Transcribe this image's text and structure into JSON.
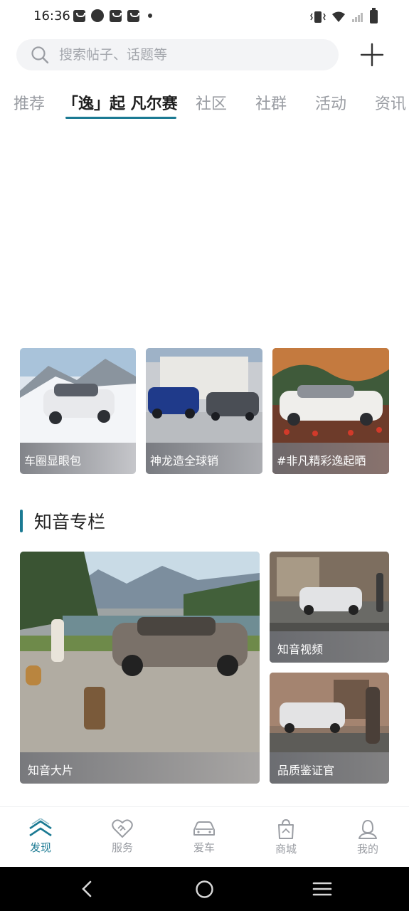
{
  "status_bar": {
    "time": "16:36"
  },
  "search": {
    "placeholder": "搜索帖子、话题等"
  },
  "tabs": [
    {
      "label": "推荐"
    },
    {
      "label": "「逸」起 凡尔赛"
    },
    {
      "label": "社区"
    },
    {
      "label": "社群"
    },
    {
      "label": "活动"
    },
    {
      "label": "资讯"
    }
  ],
  "topic_cards": [
    {
      "caption": "车圈显眼包"
    },
    {
      "caption": "神龙造全球销"
    },
    {
      "caption": "#非凡精彩逸起晒"
    }
  ],
  "section": {
    "title": "知音专栏"
  },
  "column_cards": [
    {
      "caption": "知音大片"
    },
    {
      "caption": "知音视频"
    },
    {
      "caption": "品质鉴证官"
    }
  ],
  "bottom_nav": [
    {
      "label": "发现",
      "icon": "discover-icon",
      "active": true
    },
    {
      "label": "服务",
      "icon": "service-icon",
      "active": false
    },
    {
      "label": "爱车",
      "icon": "car-icon",
      "active": false
    },
    {
      "label": "商城",
      "icon": "mall-icon",
      "active": false
    },
    {
      "label": "我的",
      "icon": "profile-icon",
      "active": false
    }
  ],
  "colors": {
    "accent": "#1b7a93",
    "inactive": "#9a9da3"
  }
}
